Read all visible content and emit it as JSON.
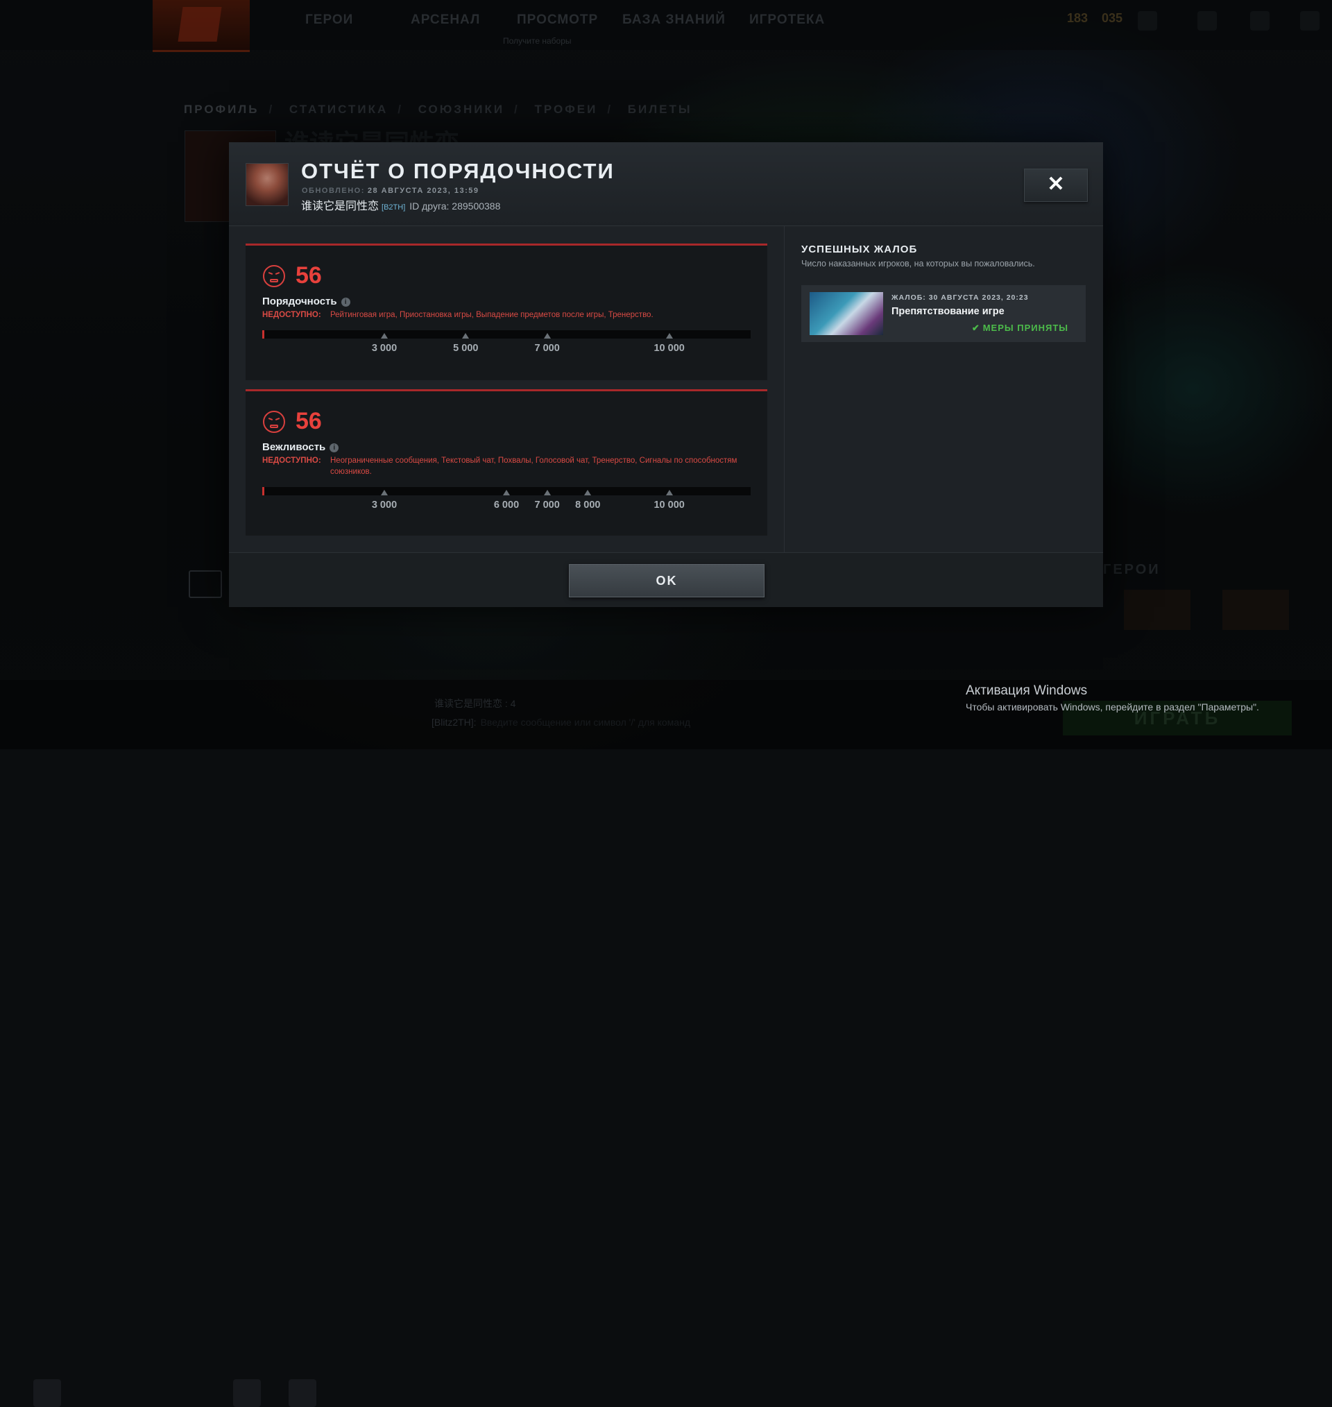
{
  "topnav": {
    "items": [
      "ГЕРОИ",
      "АРСЕНАЛ",
      "ПРОСМОТР",
      "БАЗА ЗНАНИЙ",
      "ИГРОТЕКА"
    ],
    "sub_notice": "Получите наборы",
    "currency1": "183",
    "currency2": "035"
  },
  "breadcrumb": {
    "items": [
      "ПРОФИЛЬ",
      "СТАТИСТИКА",
      "СОЮЗНИКИ",
      "ТРОФЕИ",
      "БИЛЕТЫ"
    ]
  },
  "background": {
    "profile_name": "谁读它是同性恋",
    "heroes_label": "ГЕРОИ"
  },
  "modal": {
    "title": "ОТЧЁТ О ПОРЯДОЧНОСТИ",
    "updated_label": "ОБНОВЛЕНО:",
    "updated_value": "28 АВГУСТА 2023, 13:59",
    "username": "谁读它是同性恋",
    "user_tag": "[B2TH]",
    "friend_id": "ID друга: 289500388",
    "close_symbol": "✕",
    "behavior": {
      "score": "56",
      "label": "Порядочность",
      "unavailable_key": "НЕДОСТУПНО:",
      "unavailable_text": "Рейтинговая игра, Приостановка игры, Выпадение предметов после игры, Тренерство.",
      "bar_max": 12000,
      "bar_value": 56,
      "ticks": [
        {
          "value": 3000,
          "label": "3 000"
        },
        {
          "value": 5000,
          "label": "5 000"
        },
        {
          "value": 7000,
          "label": "7 000"
        },
        {
          "value": 10000,
          "label": "10 000"
        }
      ]
    },
    "communication": {
      "score": "56",
      "label": "Вежливость",
      "unavailable_key": "НЕДОСТУПНО:",
      "unavailable_text": "Неограниченные сообщения, Текстовый чат, Похвалы, Голосовой чат, Тренерство, Сигналы по способностям союзников.",
      "bar_max": 12000,
      "bar_value": 56,
      "ticks": [
        {
          "value": 3000,
          "label": "3 000"
        },
        {
          "value": 6000,
          "label": "6 000"
        },
        {
          "value": 7000,
          "label": "7 000"
        },
        {
          "value": 8000,
          "label": "8 000"
        },
        {
          "value": 10000,
          "label": "10 000"
        }
      ]
    },
    "reports": {
      "title": "УСПЕШНЫХ ЖАЛОБ",
      "subtitle": "Число наказанных игроков, на которых вы пожаловались.",
      "items": [
        {
          "date": "ЖАЛОБ: 30 АВГУСТА 2023, 20:23",
          "reason": "Препятствование игре",
          "status": "МЕРЫ ПРИНЯТЫ",
          "status_color": "#4cbb4a"
        }
      ]
    },
    "ok_label": "OK"
  },
  "chat": {
    "line1": "谁读它是同性恋 : 4",
    "line2_name": "[Blitz2TH]:",
    "line2_placeholder": "Введите сообщение или символ '/' для команд"
  },
  "play_button": "ИГРАТЬ",
  "windows_activation": {
    "title": "Активация Windows",
    "text": "Чтобы активировать Windows, перейдите в раздел \"Параметры\"."
  },
  "colors": {
    "accent_red": "#e8413c",
    "success_green": "#4cbb4a"
  }
}
